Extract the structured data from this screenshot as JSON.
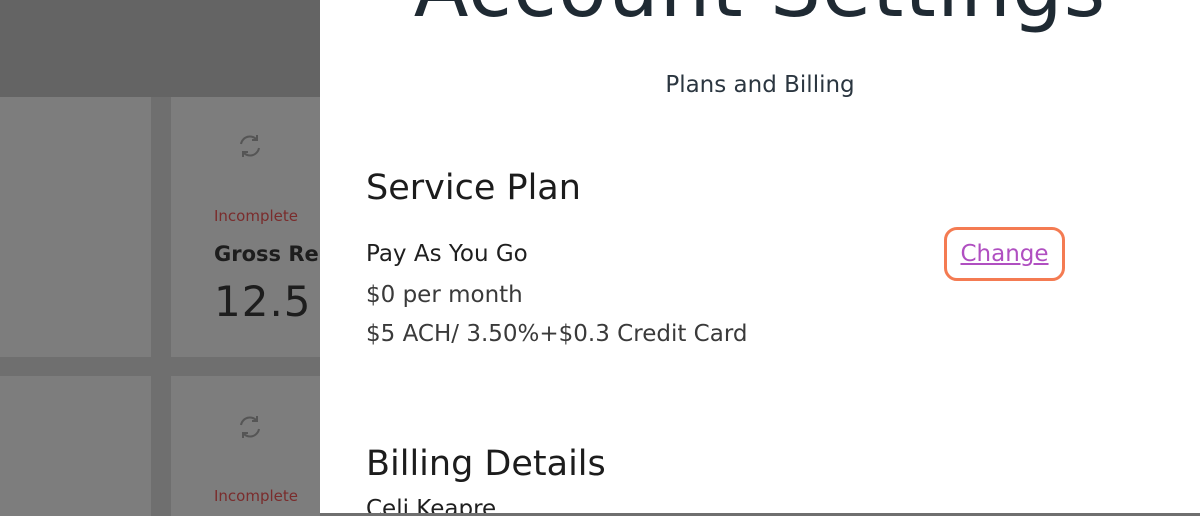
{
  "background": {
    "cards": [
      {
        "status": "Incomplete",
        "title": "Gross Re",
        "value": "12.5"
      },
      {
        "status": "Incomplete"
      }
    ]
  },
  "panel": {
    "title": "Account Settings",
    "subtitle": "Plans and Billing",
    "service_plan": {
      "heading": "Service Plan",
      "plan_name": "Pay As You Go",
      "price": "$0 per month",
      "fees": "$5 ACH/ 3.50%+$0.3 Credit Card",
      "change_label": "Change"
    },
    "billing_details": {
      "heading": "Billing Details",
      "name": "Celi Keapre"
    }
  },
  "colors": {
    "accent_outline": "#f47b52",
    "link": "#b04fc1",
    "incomplete": "#7a2c2c"
  }
}
